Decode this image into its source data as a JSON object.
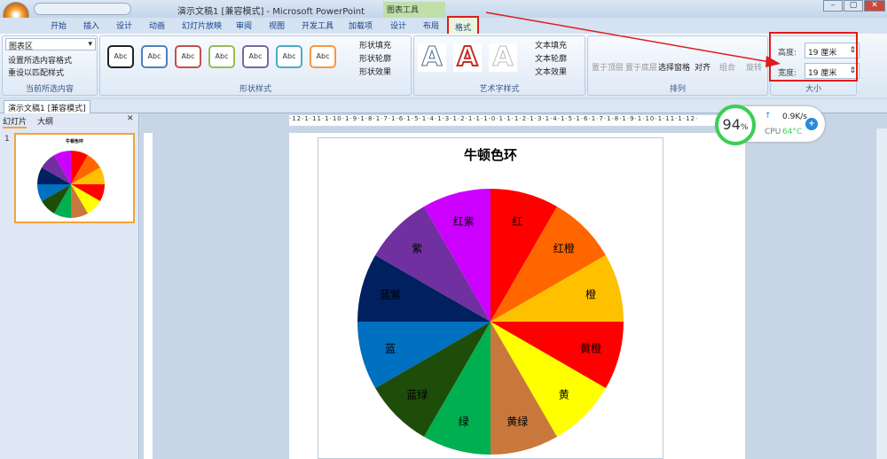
{
  "window": {
    "title": "演示文稿1 [兼容模式] - Microsoft PowerPoint",
    "tool_context": "图表工具",
    "controls": [
      "–",
      "▢",
      "✕"
    ]
  },
  "tabs": [
    "开始",
    "插入",
    "设计",
    "动画",
    "幻灯片放映",
    "审阅",
    "视图",
    "开发工具",
    "加载项",
    "设计",
    "布局",
    "格式"
  ],
  "ribbon": {
    "current_selection": {
      "dropdown": "图表区",
      "format_selection": "设置所选内容格式",
      "reset_style": "重设以匹配样式",
      "label": "当前所选内容"
    },
    "shape_styles": {
      "swatches": [
        {
          "text": "Abc",
          "color": "#222222"
        },
        {
          "text": "Abc",
          "color": "#4f81bd"
        },
        {
          "text": "Abc",
          "color": "#c0504d"
        },
        {
          "text": "Abc",
          "color": "#9bbb59"
        },
        {
          "text": "Abc",
          "color": "#8064a2"
        },
        {
          "text": "Abc",
          "color": "#4bacc6"
        },
        {
          "text": "Abc",
          "color": "#f79646"
        }
      ],
      "fill": "形状填充",
      "outline": "形状轮廓",
      "effects": "形状效果",
      "label": "形状样式"
    },
    "wordart": {
      "fill": "文本填充",
      "outline": "文本轮廓",
      "effects": "文本效果",
      "label": "艺术字样式",
      "letter": "A"
    },
    "arrange": {
      "items": [
        "置于顶层",
        "置于底层",
        "选择窗格",
        "对齐",
        "组合",
        "旋转"
      ],
      "label": "排列"
    },
    "size": {
      "height_label": "高度:",
      "height_value": "19 厘米",
      "width_label": "宽度:",
      "width_value": "19 厘米",
      "label": "大小"
    }
  },
  "document_tab": "演示文稿1 [兼容模式]",
  "left_pane": {
    "tabs": [
      "幻灯片",
      "大纲"
    ],
    "slide_number": "1"
  },
  "ruler": "·12·1·11·1·10·1·9·1·8·1·7·1·6·1·5·1·4·1·3·1·2·1·1·1·0·1·1·1·2·1·3·1·4·1·5·1·6·1·7·1·8·1·9·1·10·1·11·1·12·",
  "monitor": {
    "percent": "94",
    "percent_sign": "%",
    "speed": "0.9K/s",
    "cpu_label": "CPU",
    "cpu_temp": "64°C"
  },
  "chart_data": {
    "type": "pie",
    "title": "牛顿色环",
    "categories": [
      "红",
      "红橙",
      "橙",
      "黄橙",
      "黄",
      "黄绿",
      "绿",
      "蓝绿",
      "蓝",
      "蓝紫",
      "紫",
      "红紫"
    ],
    "values": [
      1,
      1,
      1,
      1,
      1,
      1,
      1,
      1,
      1,
      1,
      1,
      1
    ],
    "colors": [
      "#ff0000",
      "#ff6600",
      "#ffc000",
      "#ff0000",
      "#ffff00",
      "#c8783c",
      "#00b050",
      "#1e4d0a",
      "#0070c0",
      "#002060",
      "#7030a0",
      "#cc00ff"
    ],
    "start": "top",
    "direction": "clockwise",
    "legend": "none"
  }
}
